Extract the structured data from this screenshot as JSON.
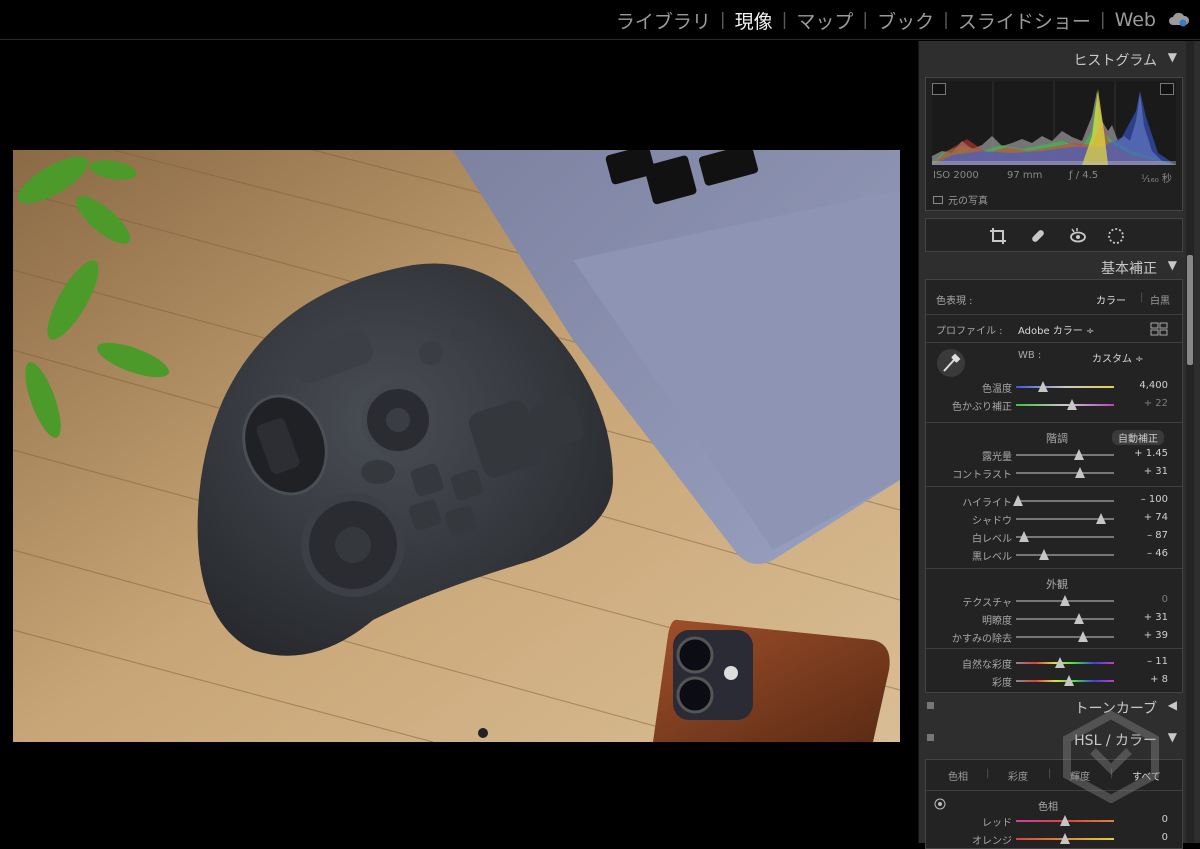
{
  "modules": {
    "items": [
      "ライブラリ",
      "現像",
      "マップ",
      "ブック",
      "スライドショー",
      "Web"
    ],
    "active": "現像"
  },
  "histogram": {
    "title": "ヒストグラム",
    "iso": "ISO 2000",
    "focal": "97 mm",
    "aperture": "ƒ / 4.5",
    "shutter": "¹⁄₁₆₀ 秒",
    "original_label": "元の写真"
  },
  "basic": {
    "title": "基本補正",
    "treatment_label": "色表現 :",
    "treatment_color": "カラー",
    "treatment_bw": "白黒",
    "profile_label": "プロファイル :",
    "profile_value": "Adobe カラー ÷",
    "wb_label": "WB :",
    "wb_value": "カスタム ÷",
    "sliders_wb": [
      {
        "label": "色温度",
        "value": "4,400",
        "pos": 0.28,
        "dim": false,
        "track": "temp"
      },
      {
        "label": "色かぶり補正",
        "value": "+ 22",
        "pos": 0.57,
        "dim": true,
        "track": "tint"
      }
    ],
    "tone_title": "階調",
    "auto_label": "自動補正",
    "sliders_tone": [
      {
        "label": "露光量",
        "value": "+ 1.45",
        "pos": 0.64,
        "dim": false
      },
      {
        "label": "コントラスト",
        "value": "+ 31",
        "pos": 0.65,
        "dim": false
      }
    ],
    "sliders_tone2": [
      {
        "label": "ハイライト",
        "value": "– 100",
        "pos": 0.02,
        "dim": false
      },
      {
        "label": "シャドウ",
        "value": "+ 74",
        "pos": 0.87,
        "dim": false
      },
      {
        "label": "白レベル",
        "value": "– 87",
        "pos": 0.08,
        "dim": false
      },
      {
        "label": "黒レベル",
        "value": "– 46",
        "pos": 0.29,
        "dim": false
      }
    ],
    "presence_title": "外観",
    "sliders_presence": [
      {
        "label": "テクスチャ",
        "value": "0",
        "pos": 0.5,
        "dim": true
      },
      {
        "label": "明瞭度",
        "value": "+ 31",
        "pos": 0.64,
        "dim": false
      },
      {
        "label": "かすみの除去",
        "value": "+ 39",
        "pos": 0.68,
        "dim": false
      }
    ],
    "sliders_sat": [
      {
        "label": "自然な彩度",
        "value": "– 11",
        "pos": 0.45,
        "dim": false,
        "track": "vib"
      },
      {
        "label": "彩度",
        "value": "+ 8",
        "pos": 0.54,
        "dim": false,
        "track": "vib"
      }
    ]
  },
  "tonecurve": {
    "title": "トーンカーブ"
  },
  "hsl": {
    "title": "HSL / カラー",
    "tabs": [
      "色相",
      "彩度",
      "輝度",
      "すべて"
    ],
    "group": "色相",
    "sliders": [
      {
        "label": "レッド",
        "value": "0",
        "pos": 0.5,
        "track": "red"
      },
      {
        "label": "オレンジ",
        "value": "0",
        "pos": 0.5,
        "track": "orange"
      }
    ]
  },
  "colors": {
    "accent": "#f2f2f2",
    "panel": "#2e2e2e",
    "subpanel": "#232323"
  }
}
